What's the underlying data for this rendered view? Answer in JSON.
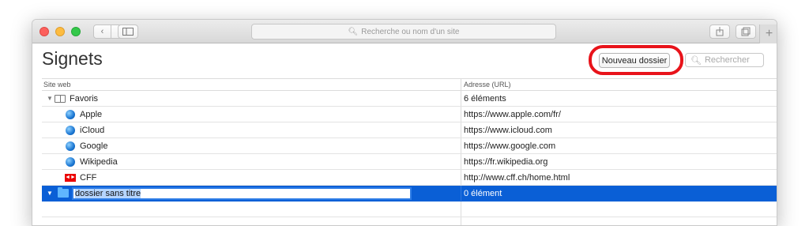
{
  "toolbar": {
    "back_icon": "chevron-left-icon",
    "forward_icon": "chevron-right-icon",
    "address_placeholder": "Recherche ou nom d'un site",
    "new_tab_label": "+"
  },
  "page": {
    "title": "Signets",
    "new_folder_label": "Nouveau dossier",
    "search_placeholder": "Rechercher",
    "annotation_color": "#e8131a"
  },
  "table": {
    "col_site": "Site web",
    "col_url": "Adresse (URL)",
    "rows": [
      {
        "name": "Favoris",
        "url": "6 éléments"
      },
      {
        "name": "Apple",
        "url": "https://www.apple.com/fr/"
      },
      {
        "name": "iCloud",
        "url": "https://www.icloud.com"
      },
      {
        "name": "Google",
        "url": "https://www.google.com"
      },
      {
        "name": "Wikipedia",
        "url": "https://fr.wikipedia.org"
      },
      {
        "name": "CFF",
        "url": "http://www.cff.ch/home.html"
      },
      {
        "name": "dossier sans titre",
        "url": "0 élément"
      }
    ],
    "selection_color": "#0a5fd6"
  }
}
